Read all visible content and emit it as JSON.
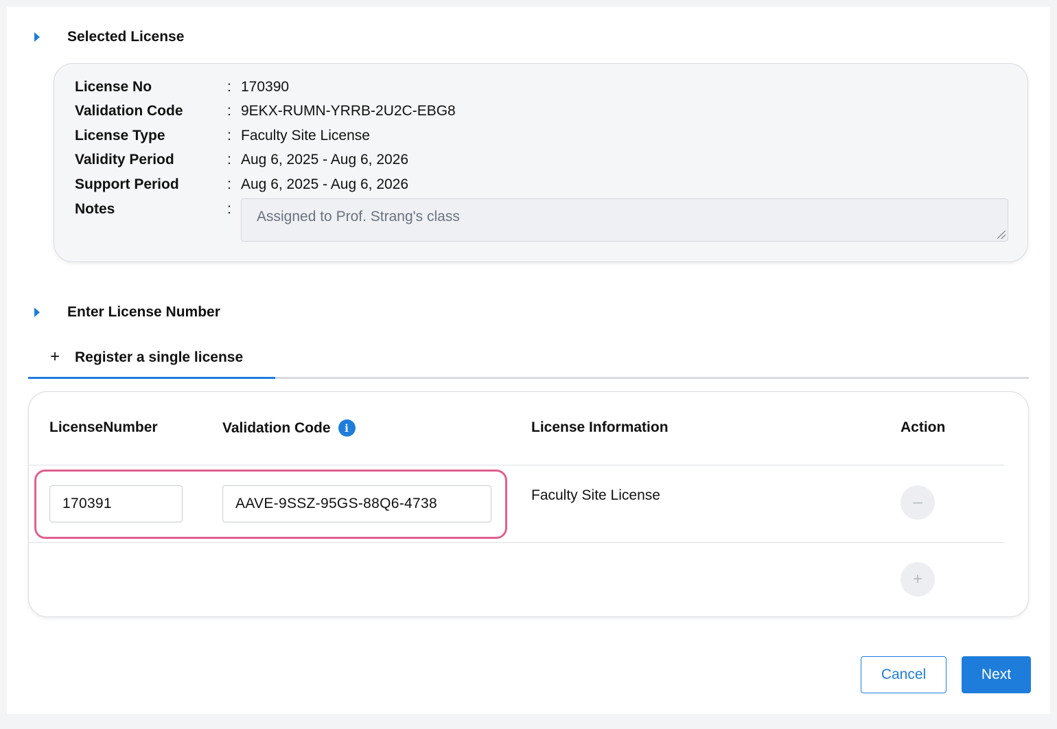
{
  "selected_license": {
    "title": "Selected License",
    "rows": [
      {
        "label": "License No",
        "value": "170390"
      },
      {
        "label": "Validation Code",
        "value": "9EKX-RUMN-YRRB-2U2C-EBG8"
      },
      {
        "label": "License Type",
        "value": "Faculty Site License"
      },
      {
        "label": "Validity Period",
        "value": "Aug 6, 2025 - Aug 6, 2026"
      },
      {
        "label": "Support Period",
        "value": "Aug 6, 2025 - Aug 6, 2026"
      }
    ],
    "colon": ":",
    "notes_label": "Notes",
    "notes_value": "Assigned to Prof. Strang's class"
  },
  "enter_license": {
    "title": "Enter License Number",
    "tab_plus": "+",
    "tab_label": "Register a single license"
  },
  "table": {
    "headers": {
      "license_number": "LicenseNumber",
      "validation_code": "Validation Code",
      "info_icon": "i",
      "license_information": "License Information",
      "action": "Action"
    },
    "rows": [
      {
        "license_number": "170391",
        "validation_code": "AAVE-9SSZ-95GS-88Q6-4738",
        "license_information": "Faculty Site License",
        "remove_symbol": "–"
      }
    ],
    "add_symbol": "+"
  },
  "footer": {
    "cancel_label": "Cancel",
    "next_label": "Next"
  },
  "colors": {
    "accent": "#1e7ddb",
    "highlight": "#e0608f"
  }
}
